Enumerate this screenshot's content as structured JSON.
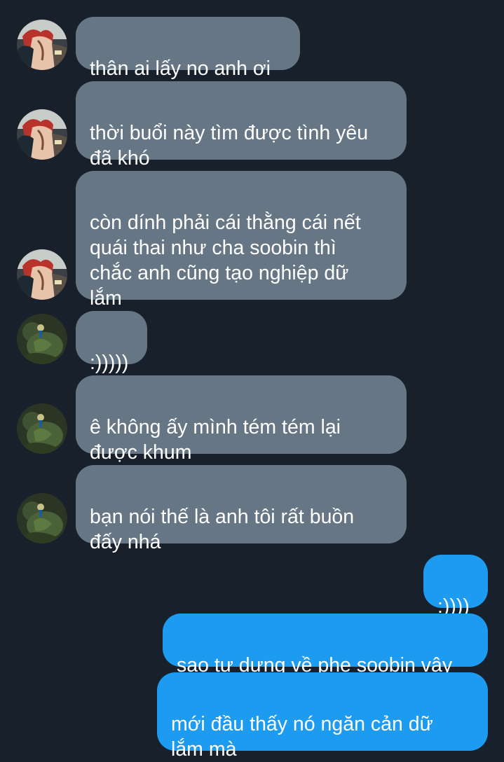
{
  "colors": {
    "background": "#18212b",
    "incoming_bubble": "#667685",
    "outgoing_bubble": "#1d9bf0",
    "text": "#ffffff"
  },
  "avatars": {
    "contact_a": "anime-character-avatar",
    "contact_b": "green-hulk-avatar"
  },
  "messages": [
    {
      "sender": "contact_a",
      "direction": "incoming",
      "text": "thân ai lấy no anh ơi"
    },
    {
      "sender": "contact_a",
      "direction": "incoming",
      "text": "thời buổi này tìm được tình yêu\nđã khó"
    },
    {
      "sender": "contact_a",
      "direction": "incoming",
      "text": "còn dính phải cái thằng cái nết\nquái thai như cha soobin thì\nchắc anh cũng tạo nghiệp dữ\nlắm"
    },
    {
      "sender": "contact_b",
      "direction": "incoming",
      "text": ":)))))"
    },
    {
      "sender": "contact_b",
      "direction": "incoming",
      "text": "ê không ấy mình tém tém lại\nđược khum"
    },
    {
      "sender": "contact_b",
      "direction": "incoming",
      "text": "bạn nói thế là anh tôi rất buồn\nđấy nhá"
    },
    {
      "sender": "me",
      "direction": "outgoing",
      "text": ":))))"
    },
    {
      "sender": "me",
      "direction": "outgoing",
      "text": "sao tự dưng về phe soobin vậy"
    },
    {
      "sender": "me",
      "direction": "outgoing",
      "text": "mới đầu thấy nó ngăn cản dữ\nlắm mà"
    }
  ]
}
